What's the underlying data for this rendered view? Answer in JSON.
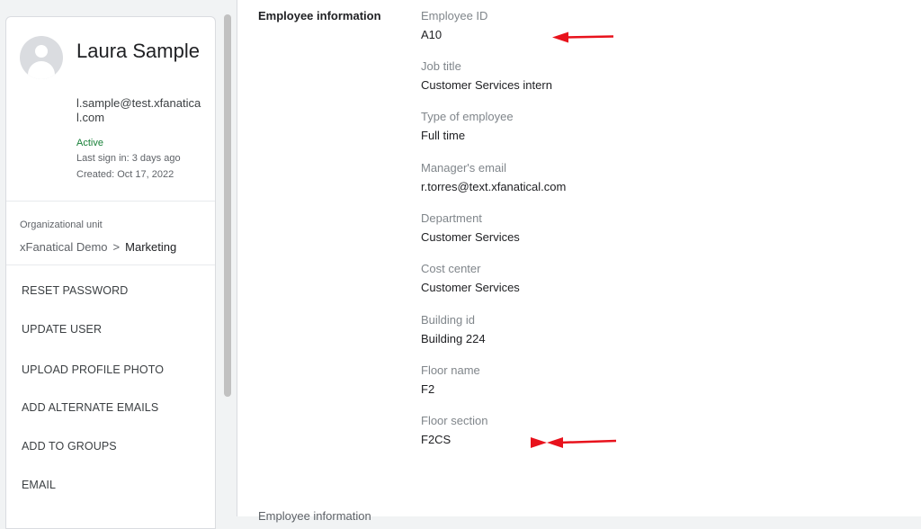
{
  "user": {
    "name": "Laura Sample",
    "email": "l.sample@test.xfanatical.com",
    "status": "Active",
    "last_sign_in": "Last sign in: 3 days ago",
    "created": "Created: Oct 17, 2022"
  },
  "org_unit": {
    "label": "Organizational unit",
    "parent": "xFanatical Demo",
    "separator": ">",
    "current": "Marketing"
  },
  "actions": [
    {
      "label": "RESET PASSWORD"
    },
    {
      "label": "UPDATE USER"
    },
    {
      "label": "UPLOAD PROFILE PHOTO"
    },
    {
      "label": "ADD ALTERNATE EMAILS"
    },
    {
      "label": "ADD TO GROUPS"
    },
    {
      "label": "EMAIL"
    }
  ],
  "employee_info": {
    "title": "Employee information",
    "fields": [
      {
        "label": "Employee ID",
        "value": "A10"
      },
      {
        "label": "Job title",
        "value": "Customer Services intern"
      },
      {
        "label": "Type of employee",
        "value": "Full time"
      },
      {
        "label": "Manager's email",
        "value": "r.torres@text.xfanatical.com"
      },
      {
        "label": "Department",
        "value": "Customer Services"
      },
      {
        "label": "Cost center",
        "value": "Customer Services"
      },
      {
        "label": "Building id",
        "value": "Building 224"
      },
      {
        "label": "Floor name",
        "value": "F2"
      },
      {
        "label": "Floor section",
        "value": "F2CS"
      }
    ]
  },
  "next_section": {
    "title": "Employee information"
  },
  "colors": {
    "annotation_arrow": "#e8121c",
    "status_active": "#188038"
  }
}
